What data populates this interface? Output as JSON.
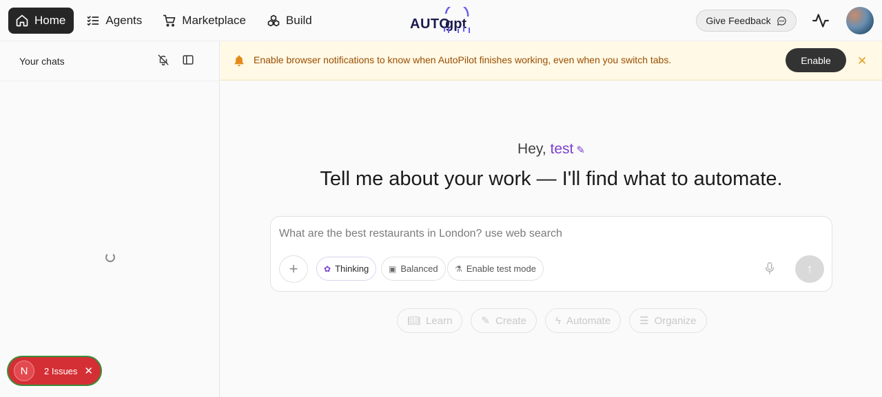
{
  "nav": {
    "items": [
      {
        "label": "Home",
        "icon": "home-icon",
        "active": true
      },
      {
        "label": "Agents",
        "icon": "list-check-icon",
        "active": false
      },
      {
        "label": "Marketplace",
        "icon": "cart-icon",
        "active": false
      },
      {
        "label": "Build",
        "icon": "cubes-icon",
        "active": false
      }
    ],
    "logo_text": "AUTOGPT",
    "feedback_label": "Give Feedback"
  },
  "sidebar": {
    "title": "Your chats"
  },
  "issues": {
    "avatar_letter": "N",
    "label": "2 Issues"
  },
  "banner": {
    "text": "Enable browser notifications to know when AutoPilot finishes working, even when you switch tabs.",
    "enable_label": "Enable"
  },
  "main": {
    "greeting_prefix": "Hey,",
    "user_name": "test",
    "headline": "Tell me about your work — I'll find what to automate.",
    "composer_placeholder": "What are the best restaurants in London? use web search",
    "chips": [
      {
        "label": "Thinking",
        "icon": "brain-icon"
      },
      {
        "label": "Balanced",
        "icon": "chip-cpu-icon"
      },
      {
        "label": "Enable test mode",
        "icon": "flask-icon"
      }
    ],
    "suggestions": [
      {
        "label": "Learn",
        "icon": "book-icon"
      },
      {
        "label": "Create",
        "icon": "pen-icon"
      },
      {
        "label": "Automate",
        "icon": "lightning-icon"
      },
      {
        "label": "Organize",
        "icon": "list-icon"
      }
    ]
  },
  "colors": {
    "accent": "#7b3fd1",
    "banner_bg": "#fff9e6",
    "banner_text": "#9a4d00",
    "issues_red": "#d42f35"
  }
}
